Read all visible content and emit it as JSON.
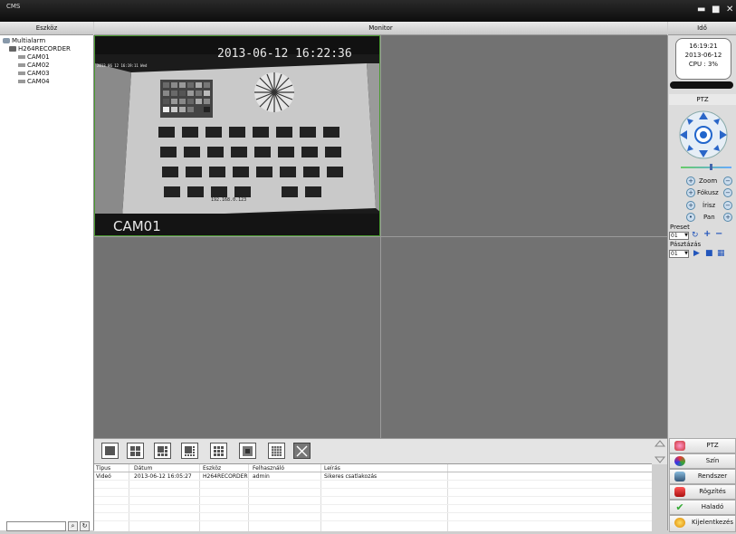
{
  "app": {
    "title": "CMS"
  },
  "header": {
    "left": "Eszköz",
    "center": "Monitor",
    "right": "Idő"
  },
  "tree": {
    "root": "Multialarm",
    "recorder": "H264RECORDER",
    "cameras": [
      "CAM01",
      "CAM02",
      "CAM03",
      "CAM04"
    ]
  },
  "video": {
    "cell1_timestamp": "2013-06-12  16:22:36",
    "cell1_small_osd": "2013 06 12 16:19:11 Wed",
    "cell1_ip": "192.168.0.123",
    "cell1_label": "CAM01"
  },
  "status": {
    "time": "16:19:21",
    "date": "2013-06-12",
    "cpu": "CPU : 3%"
  },
  "ptz": {
    "title": "PTZ",
    "controls": [
      "Zoom",
      "Fókusz",
      "Írisz",
      "Pan"
    ],
    "preset_label": "Preset",
    "preset_value": "01",
    "tour_label": "Pásztázás",
    "tour_value": "01"
  },
  "log": {
    "columns": [
      "Típus",
      "Dátum",
      "Eszköz",
      "Felhasználó",
      "Leírás"
    ],
    "rows": [
      {
        "type": "Videó",
        "date": "2013-06-12 16:05:27",
        "device": "H264RECORDER",
        "user": "admin",
        "desc": "Sikeres csatlakozás"
      }
    ]
  },
  "menu": [
    "PTZ",
    "Szín",
    "Rendszer",
    "Rögzítés",
    "Haladó",
    "Kijelentkezés"
  ],
  "colors": {
    "selected_border": "#5a9a3a",
    "grid_bg": "#727272"
  }
}
